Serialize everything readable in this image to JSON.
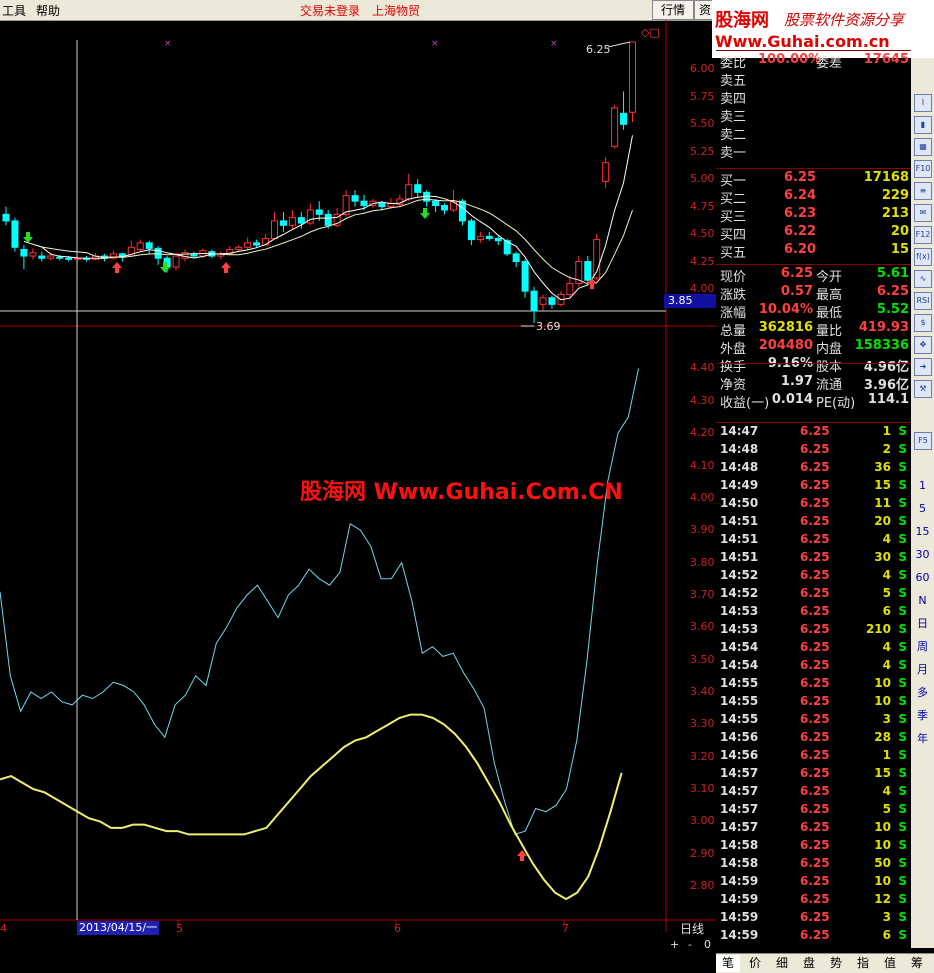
{
  "menu": {
    "tools": "工具",
    "help": "帮助"
  },
  "status": {
    "login": "交易未登录",
    "stock_name": "上海物贸"
  },
  "toolbar": {
    "quote_btn": "行情",
    "info_btn": "资"
  },
  "watermark": {
    "brand": "股海网",
    "slogan": "股票软件资源分享",
    "url": "Www.Guhai.com.cn",
    "center": "股海网 Www.Guhai.Com.CN"
  },
  "quote": {
    "weibi_label": "委比",
    "weibi_value": "100.00%",
    "weicha_label": "委差",
    "weicha_value": "17645",
    "sell": [
      {
        "label": "卖五"
      },
      {
        "label": "卖四"
      },
      {
        "label": "卖三"
      },
      {
        "label": "卖二"
      },
      {
        "label": "卖一"
      }
    ],
    "buy": [
      {
        "label": "买一",
        "price": "6.25",
        "vol": "17168"
      },
      {
        "label": "买二",
        "price": "6.24",
        "vol": "229"
      },
      {
        "label": "买三",
        "price": "6.23",
        "vol": "213"
      },
      {
        "label": "买四",
        "price": "6.22",
        "vol": "20"
      },
      {
        "label": "买五",
        "price": "6.20",
        "vol": "15"
      }
    ],
    "stats": [
      {
        "l1": "现价",
        "v1": "6.25",
        "l2": "今开",
        "v2": "5.61",
        "c1": "#ff4040",
        "c2": "#00e000"
      },
      {
        "l1": "涨跌",
        "v1": "0.57",
        "l2": "最高",
        "v2": "6.25",
        "c1": "#ff4040",
        "c2": "#ff4040"
      },
      {
        "l1": "涨幅",
        "v1": "10.04%",
        "l2": "最低",
        "v2": "5.52",
        "c1": "#ff4040",
        "c2": "#00e000"
      },
      {
        "l1": "总量",
        "v1": "362816",
        "l2": "量比",
        "v2": "419.93",
        "c1": "#e0e000",
        "c2": "#ff4040"
      },
      {
        "l1": "外盘",
        "v1": "204480",
        "l2": "内盘",
        "v2": "158336",
        "c1": "#ff4040",
        "c2": "#00e000"
      },
      {
        "l1": "换手",
        "v1": "9.16%",
        "l2": "股本",
        "v2": "4.96亿",
        "c1": "#e0e0e0",
        "c2": "#e0e0e0"
      },
      {
        "l1": "净资",
        "v1": "1.97",
        "l2": "流通",
        "v2": "3.96亿",
        "c1": "#e0e0e0",
        "c2": "#e0e0e0"
      },
      {
        "l1": "收益(一)",
        "v1": "0.014",
        "l2": "PE(动)",
        "v2": "114.1",
        "c1": "#e0e0e0",
        "c2": "#e0e0e0"
      }
    ]
  },
  "ticks": [
    {
      "t": "14:47",
      "p": "6.25",
      "v": "1",
      "s": "S"
    },
    {
      "t": "14:48",
      "p": "6.25",
      "v": "2",
      "s": "S"
    },
    {
      "t": "14:48",
      "p": "6.25",
      "v": "36",
      "s": "S"
    },
    {
      "t": "14:49",
      "p": "6.25",
      "v": "15",
      "s": "S"
    },
    {
      "t": "14:50",
      "p": "6.25",
      "v": "11",
      "s": "S"
    },
    {
      "t": "14:51",
      "p": "6.25",
      "v": "20",
      "s": "S"
    },
    {
      "t": "14:51",
      "p": "6.25",
      "v": "4",
      "s": "S"
    },
    {
      "t": "14:51",
      "p": "6.25",
      "v": "30",
      "s": "S"
    },
    {
      "t": "14:52",
      "p": "6.25",
      "v": "4",
      "s": "S"
    },
    {
      "t": "14:52",
      "p": "6.25",
      "v": "5",
      "s": "S"
    },
    {
      "t": "14:53",
      "p": "6.25",
      "v": "6",
      "s": "S"
    },
    {
      "t": "14:53",
      "p": "6.25",
      "v": "210",
      "s": "S"
    },
    {
      "t": "14:54",
      "p": "6.25",
      "v": "4",
      "s": "S"
    },
    {
      "t": "14:54",
      "p": "6.25",
      "v": "4",
      "s": "S"
    },
    {
      "t": "14:55",
      "p": "6.25",
      "v": "10",
      "s": "S"
    },
    {
      "t": "14:55",
      "p": "6.25",
      "v": "10",
      "s": "S"
    },
    {
      "t": "14:55",
      "p": "6.25",
      "v": "3",
      "s": "S"
    },
    {
      "t": "14:56",
      "p": "6.25",
      "v": "28",
      "s": "S"
    },
    {
      "t": "14:56",
      "p": "6.25",
      "v": "1",
      "s": "S"
    },
    {
      "t": "14:57",
      "p": "6.25",
      "v": "15",
      "s": "S"
    },
    {
      "t": "14:57",
      "p": "6.25",
      "v": "4",
      "s": "S"
    },
    {
      "t": "14:57",
      "p": "6.25",
      "v": "5",
      "s": "S"
    },
    {
      "t": "14:57",
      "p": "6.25",
      "v": "10",
      "s": "S"
    },
    {
      "t": "14:58",
      "p": "6.25",
      "v": "10",
      "s": "S"
    },
    {
      "t": "14:58",
      "p": "6.25",
      "v": "50",
      "s": "S"
    },
    {
      "t": "14:59",
      "p": "6.25",
      "v": "10",
      "s": "S"
    },
    {
      "t": "14:59",
      "p": "6.25",
      "v": "12",
      "s": "S"
    },
    {
      "t": "14:59",
      "p": "6.25",
      "v": "3",
      "s": "S"
    },
    {
      "t": "14:59",
      "p": "6.25",
      "v": "6",
      "s": "S"
    }
  ],
  "right_toolbar": {
    "rsi": "RSI",
    "f5": "F5",
    "periods": [
      "1",
      "5",
      "15",
      "30",
      "60",
      "N",
      "日",
      "周",
      "月",
      "多",
      "季",
      "年"
    ]
  },
  "bottom_tabs": [
    "笔",
    "价",
    "细",
    "盘",
    "势",
    "指",
    "值",
    "筹"
  ],
  "chart_axis": {
    "period_label": "日线",
    "plus": "+",
    "minus": "-",
    "zero": "0",
    "cursor_date": "2013/04/15/一",
    "month_labels": [
      "4",
      "5",
      "6",
      "7"
    ],
    "price_ticks": [
      "6.00",
      "5.75",
      "5.50",
      "5.25",
      "5.00",
      "4.75",
      "4.50",
      "4.25",
      "4.00"
    ],
    "cursor_price": "3.85",
    "ind_ticks": [
      "4.40",
      "4.30",
      "4.20",
      "4.10",
      "4.00",
      "3.90",
      "3.80",
      "3.70",
      "3.60",
      "3.50",
      "3.40",
      "3.30",
      "3.20",
      "3.10",
      "3.00",
      "2.90",
      "2.80"
    ],
    "high_label": "6.25",
    "low_label": "3.69"
  },
  "colors": {
    "up": "#ff3030",
    "down": "#00ffff",
    "ma_white": "#ffffff",
    "ma_yellow": "#f0f070",
    "ind_cyan": "#6fd8f0"
  }
}
